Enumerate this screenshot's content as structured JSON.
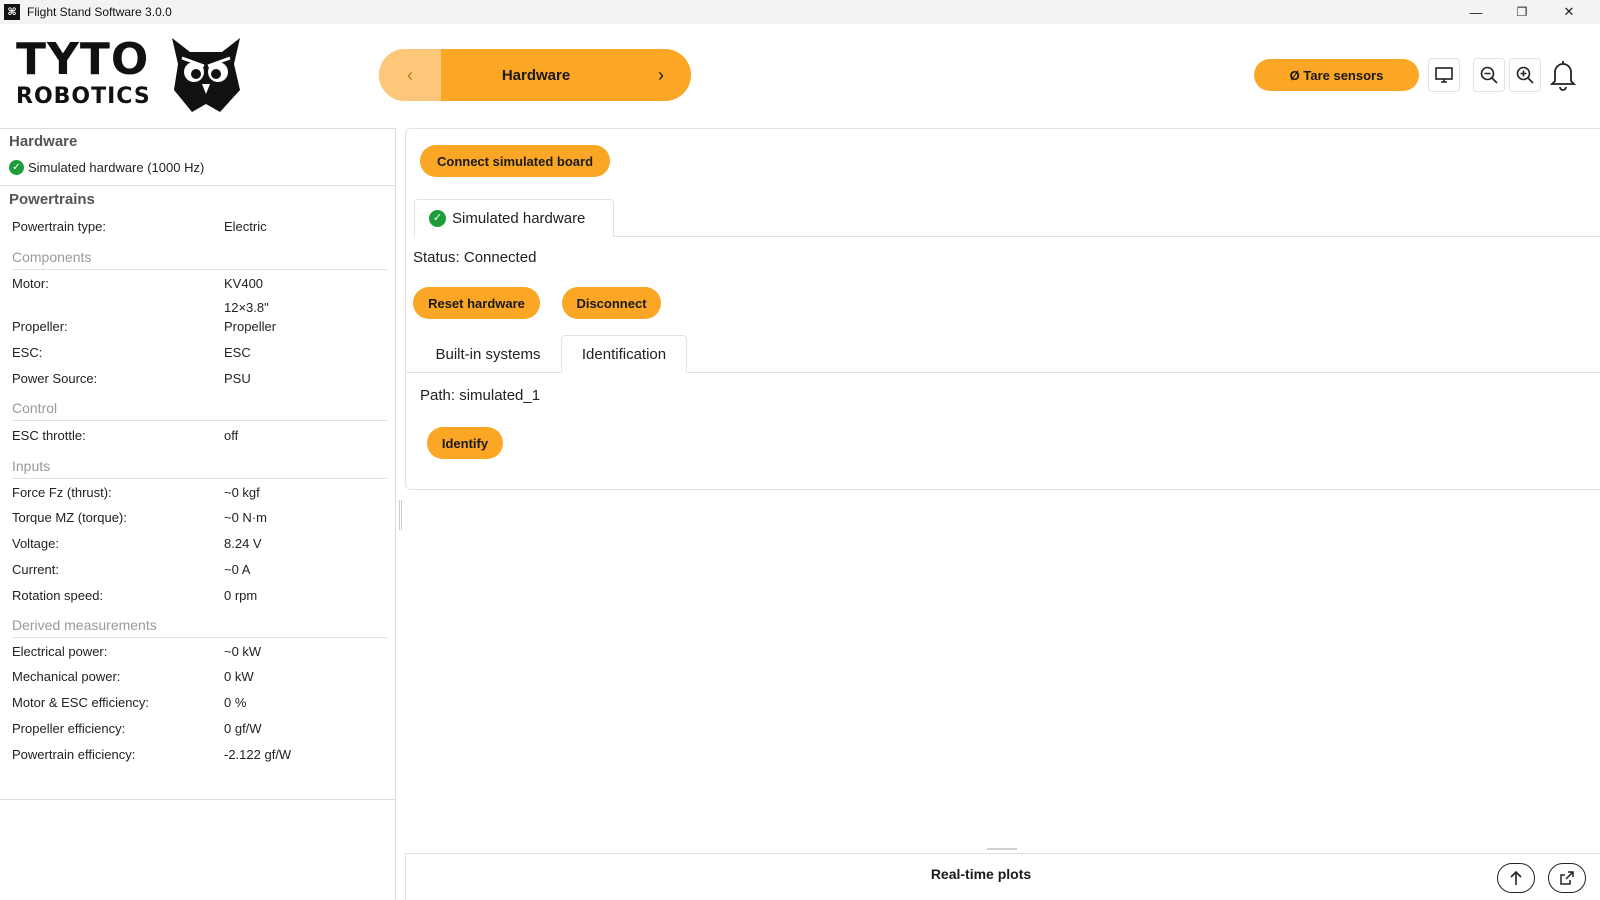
{
  "window": {
    "title": "Flight Stand Software 3.0.0",
    "minimize": "—",
    "maximize": "❐",
    "close": "✕"
  },
  "logo": {
    "line1": "TYTO",
    "line2": "ROBOTICS"
  },
  "nav": {
    "prev": "‹",
    "label": "Hardware",
    "next": "›"
  },
  "header": {
    "tare_label": "Ø Tare sensors"
  },
  "left": {
    "hardware_title": "Hardware",
    "hardware_status": "Simulated hardware (1000 Hz)",
    "powertrains_title": "Powertrains",
    "powertrain_type": {
      "key": "Powertrain type:",
      "value": "Electric"
    },
    "components_title": "Components",
    "components": [
      {
        "key": "Motor:",
        "value": "KV400"
      },
      {
        "key": "",
        "value": "12×3.8\""
      },
      {
        "key": "Propeller:",
        "value": "Propeller"
      },
      {
        "key": "ESC:",
        "value": "ESC"
      },
      {
        "key": "Power Source:",
        "value": "PSU"
      }
    ],
    "control_title": "Control",
    "control": [
      {
        "key": "ESC throttle:",
        "value": "off"
      }
    ],
    "inputs_title": "Inputs",
    "inputs": [
      {
        "key": "Force Fz (thrust):",
        "value": "~0 kgf"
      },
      {
        "key": "Torque MZ (torque):",
        "value": "~0 N·m"
      },
      {
        "key": "Voltage:",
        "value": "8.24 V"
      },
      {
        "key": "Current:",
        "value": "~0 A"
      },
      {
        "key": "Rotation speed:",
        "value": "0 rpm"
      }
    ],
    "derived_title": "Derived measurements",
    "derived": [
      {
        "key": "Electrical power:",
        "value": "~0 kW"
      },
      {
        "key": "Mechanical power:",
        "value": "0 kW"
      },
      {
        "key": "Motor & ESC efficiency:",
        "value": "0 %"
      },
      {
        "key": "Propeller efficiency:",
        "value": "0 gf/W"
      },
      {
        "key": "Powertrain efficiency:",
        "value": "-2.122 gf/W"
      }
    ]
  },
  "main": {
    "connect_label": "Connect simulated board",
    "device_tab": "Simulated hardware",
    "status_text": "Status: Connected",
    "reset_label": "Reset hardware",
    "disconnect_label": "Disconnect",
    "subtabs": [
      "Built-in systems",
      "Identification"
    ],
    "path_text": "Path: simulated_1",
    "identify_label": "Identify"
  },
  "bottom": {
    "label": "Real-time plots"
  },
  "colors": {
    "accent": "#fba624",
    "accent_light": "#fcc779",
    "ok": "#1e9e3a"
  }
}
